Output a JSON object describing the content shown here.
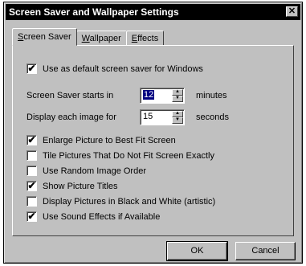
{
  "window": {
    "title": "Screen Saver and Wallpaper Settings",
    "close_glyph": "✕"
  },
  "tabs": [
    {
      "prefix": "",
      "underline": "S",
      "rest": "creen Saver",
      "active": true
    },
    {
      "prefix": "",
      "underline": "W",
      "rest": "allpaper",
      "active": false
    },
    {
      "prefix": "",
      "underline": "E",
      "rest": "ffects",
      "active": false
    }
  ],
  "default_checkbox": {
    "label": "Use as default screen saver for Windows",
    "checked": true
  },
  "spinners": [
    {
      "label": "Screen Saver starts in",
      "value": "12",
      "unit": "minutes",
      "selected": true
    },
    {
      "label": "Display each image for",
      "value": "15",
      "unit": "seconds",
      "selected": false
    }
  ],
  "options": [
    {
      "label": "Enlarge Picture to Best Fit Screen",
      "checked": true
    },
    {
      "label": "Tile Pictures That Do Not Fit Screen Exactly",
      "checked": false
    },
    {
      "label": "Use Random Image Order",
      "checked": false
    },
    {
      "label": "Show Picture Titles",
      "checked": true
    },
    {
      "label": "Display Pictures in Black and White (artistic)",
      "checked": false
    },
    {
      "label": "Use Sound Effects if Available",
      "checked": true
    }
  ],
  "buttons": {
    "ok": "OK",
    "cancel": "Cancel"
  },
  "glyphs": {
    "check": "✔",
    "up": "▲",
    "down": "▼"
  }
}
